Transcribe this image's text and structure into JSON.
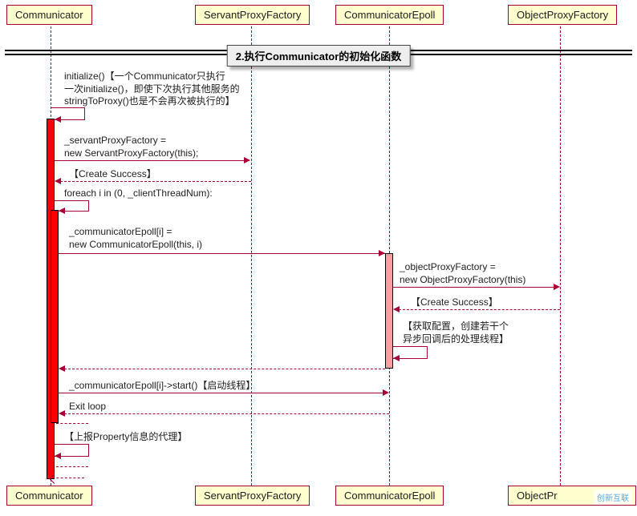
{
  "participants": {
    "communicator": "Communicator",
    "servantProxyFactory": "ServantProxyFactory",
    "communicatorEpoll": "CommunicatorEpoll",
    "objectProxyFactory": "ObjectProxyFactory"
  },
  "divider": "2.执行Communicator的初始化函数",
  "messages": {
    "m1": "initialize()【一个Communicator只执行\n一次initialize()，即使下次执行其他服务的\nstringToProxy()也是不会再次被执行的】",
    "m2": "_servantProxyFactory =\nnew ServantProxyFactory(this);",
    "m3": "【Create Success】",
    "m4": "foreach i in (0, _clientThreadNum):",
    "m5": "_communicatorEpoll[i] =\nnew CommunicatorEpoll(this, i)",
    "m6": "_objectProxyFactory =\nnew ObjectProxyFactory(this)",
    "m7": "【Create Success】",
    "m8": "【获取配置，创建若干个\n异步回调后的处理线程】",
    "m9": "_communicatorEpoll[i]->start()【启动线程】",
    "m10": "Exit loop",
    "m11": "【上报Property信息的代理】"
  },
  "watermark_text": "创新互联"
}
